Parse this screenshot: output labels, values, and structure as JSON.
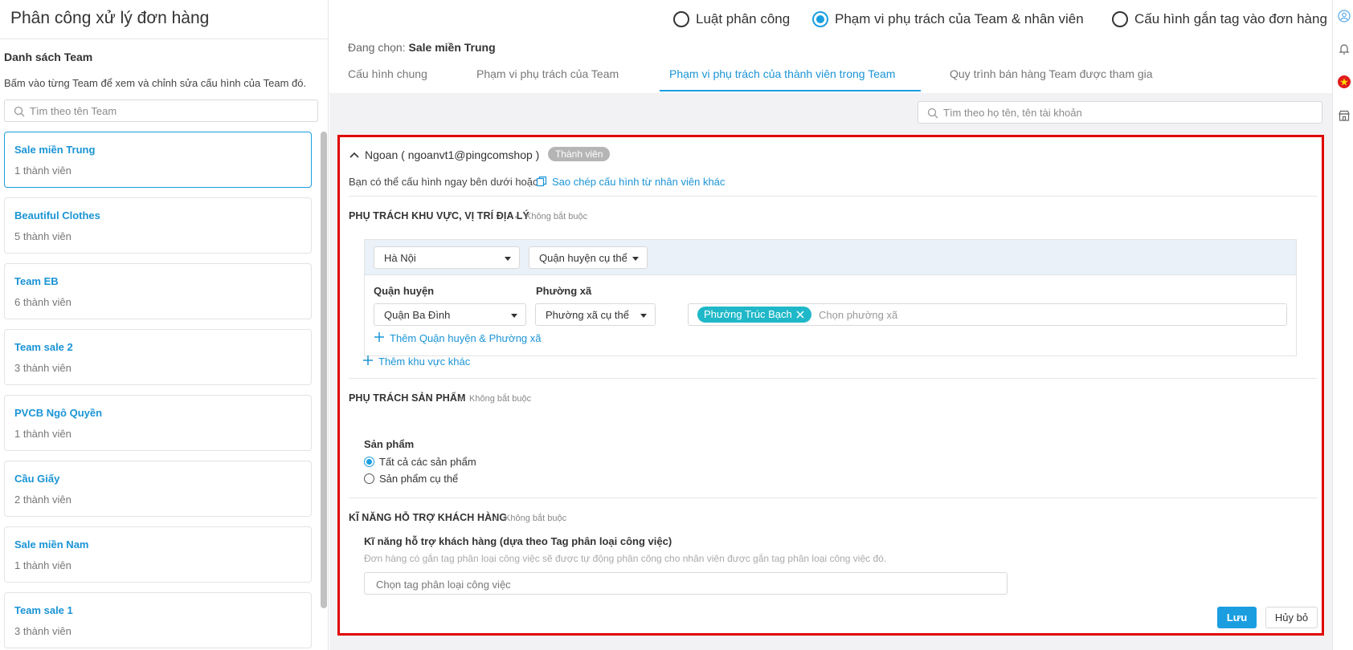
{
  "left": {
    "title": "Phân công xử lý đơn hàng",
    "list_title": "Danh sách Team",
    "list_hint": "Bấm vào từng Team để xem và chỉnh sửa cấu hình của Team đó.",
    "search_placeholder": "Tìm theo tên Team",
    "teams": [
      {
        "name": "Sale miền Trung",
        "count": "1 thành viên",
        "active": true
      },
      {
        "name": "Beautiful Clothes",
        "count": "5 thành viên"
      },
      {
        "name": "Team EB",
        "count": "6 thành viên"
      },
      {
        "name": "Team sale 2",
        "count": "3 thành viên"
      },
      {
        "name": "PVCB Ngô Quyền",
        "count": "1 thành viên"
      },
      {
        "name": "Cầu Giấy",
        "count": "2 thành viên"
      },
      {
        "name": "Sale miền Nam",
        "count": "1 thành viên"
      },
      {
        "name": "Team sale 1",
        "count": "3 thành viên"
      }
    ]
  },
  "header": {
    "radio_rule": "Luật phân công",
    "radio_scope": "Phạm vi phụ trách của Team & nhân viên",
    "radio_tag": "Cấu hình gắn tag vào đơn hàng",
    "selected_prefix": "Đang chọn:",
    "selected_team": "Sale miền Trung"
  },
  "tabs": {
    "general": "Cấu hình chung",
    "team_scope": "Phạm vi phụ trách của Team",
    "member_scope": "Phạm vi phụ trách của thành viên trong Team",
    "sales_process": "Quy trình bán hàng Team được tham gia"
  },
  "member_search_placeholder": "Tìm theo họ tên, tên tài khoản",
  "member": {
    "name": "Ngoan ( ngoanvt1@pingcomshop )",
    "badge": "Thành viên",
    "copy_prefix": "Bạn có thể cấu hình ngay bên dưới hoặc",
    "copy_link": "Sao chép cấu hình từ nhân viên khác"
  },
  "geo": {
    "title": "PHỤ TRÁCH KHU VỰC, VỊ TRÍ ĐỊA LÝ",
    "optional": "Không bắt buộc",
    "province": "Hà Nội",
    "district_mode": "Quận huyện cụ thể",
    "district_label": "Quận huyện",
    "ward_label": "Phường xã",
    "district": "Quận Ba Đình",
    "ward_mode": "Phường xã cụ thể",
    "ward_chip": "Phường Trúc Bạch",
    "ward_placeholder": "Chọn phường xã",
    "add_district": "Thêm Quận huyện & Phường xã",
    "add_area": "Thêm khu vực khác"
  },
  "product": {
    "title": "PHỤ TRÁCH SẢN PHẨM",
    "optional": "Không bắt buộc",
    "label": "Sản phẩm",
    "opt_all": "Tất cả các sản phẩm",
    "opt_specific": "Sản phẩm cụ thể"
  },
  "skill": {
    "title": "KĨ NĂNG HỖ TRỢ KHÁCH HÀNG",
    "optional": "Không bắt buộc",
    "label": "Kĩ năng hỗ trợ khách hàng (dựa theo Tag phân loại công việc)",
    "hint": "Đơn hàng có gắn tag phân loại công việc sẽ được tự động phân công cho nhân viên được gắn tag phân loại công việc đó.",
    "placeholder": "Chọn tag phân loại công việc"
  },
  "actions": {
    "save": "Lưu",
    "cancel": "Hủy bỏ"
  },
  "colors": {
    "accent": "#1a9ee0",
    "chip": "#1fb8c8",
    "highlight": "#e00000"
  },
  "icons": [
    "search-icon",
    "chevron-up-icon",
    "copy-icon",
    "plus-icon",
    "close-icon",
    "user-icon",
    "bell-icon",
    "vietnam-flag-icon",
    "store-icon"
  ]
}
